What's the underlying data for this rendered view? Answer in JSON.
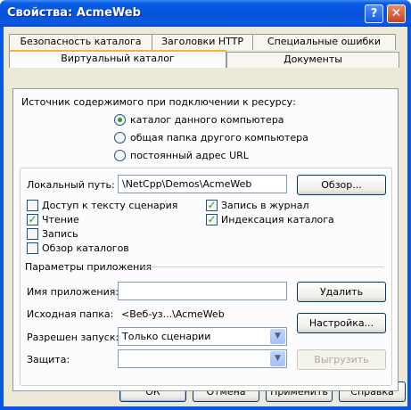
{
  "window": {
    "title": "Свойства: AcmeWeb",
    "help_label": "?",
    "close_label": "✕"
  },
  "tabs_back": [
    "Безопасность каталога",
    "Заголовки HTTP",
    "Специальные ошибки"
  ],
  "tabs_front": [
    "Виртуальный каталог",
    "Документы"
  ],
  "active_tab": "Виртуальный каталог",
  "source": {
    "heading": "Источник содержимого при подключении к ресурсу:",
    "options": [
      "каталог данного компьютера",
      "общая папка другого компьютера",
      "постоянный адрес URL"
    ],
    "selected": "каталог данного компьютера"
  },
  "local_path": {
    "label": "Локальный путь:",
    "value": "\\NetCpp\\Demos\\AcmeWeb",
    "browse_label": "Обзор..."
  },
  "checkboxes_left": [
    {
      "label": "Доступ к тексту сценария",
      "checked": false
    },
    {
      "label": "Чтение",
      "checked": true
    },
    {
      "label": "Запись",
      "checked": false
    },
    {
      "label": "Обзор каталогов",
      "checked": false
    }
  ],
  "checkboxes_right": [
    {
      "label": "Запись в журнал",
      "checked": true
    },
    {
      "label": "Индексация каталога",
      "checked": true
    }
  ],
  "app_settings": {
    "heading": "Параметры приложения",
    "app_name_label": "Имя приложения:",
    "app_name_value": "",
    "delete_label": "Удалить",
    "start_folder_label": "Исходная папка:",
    "start_folder_value": "<Веб-уз...\\AcmeWeb",
    "config_label": "Настройка...",
    "execute_label": "Разрешен запуск:",
    "execute_value": "Только сценарии",
    "protection_label": "Защита:",
    "protection_value": "",
    "unload_label": "Выгрузить"
  },
  "footer": {
    "ok": "ОК",
    "cancel": "Отмена",
    "apply": "Применить",
    "help": "Справка"
  },
  "colors": {
    "title_bar": "#0a5ae0",
    "dialog_bg": "#ece9d8",
    "tab_highlight": "#f6b043",
    "check_mark": "#21a121"
  }
}
